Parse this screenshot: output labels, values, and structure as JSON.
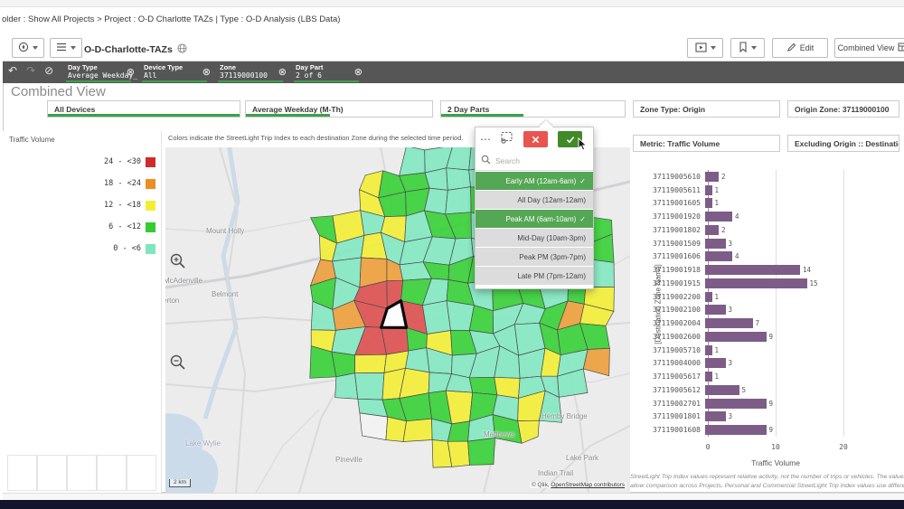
{
  "window": {
    "breadcrumb": "older : Show All Projects   >   Project : O-D Charlotte TAZs   |   Type : O-D Analysis (LBS Data)"
  },
  "toolbar": {
    "app_title": "O-D-Charlotte-TAZs",
    "edit_label": "Edit",
    "view_selector_label": "Combined View"
  },
  "selections": [
    {
      "label": "Day Type",
      "value": "Average Weekday_"
    },
    {
      "label": "Device Type",
      "value": "All"
    },
    {
      "label": "Zone",
      "value": "37119000100"
    },
    {
      "label": "Day Part",
      "value": "2 of 6"
    }
  ],
  "page": {
    "title": "Combined View"
  },
  "filters": {
    "all_devices": "All Devices",
    "day_type": "Average Weekday (M-Th)",
    "day_parts": "2 Day Parts",
    "zone_type": "Zone Type: Origin",
    "origin_zone": "Origin Zone: 37119000100",
    "metric": "Metric: Traffic Volume",
    "excluding": "Excluding Origin :: Destination"
  },
  "legend": {
    "title": "Traffic Volume",
    "items": [
      {
        "label": "24 - <30",
        "color": "#cf2b2b"
      },
      {
        "label": "18 - <24",
        "color": "#ef8d24"
      },
      {
        "label": "12 - <18",
        "color": "#f4ee33"
      },
      {
        "label": "6 - <12",
        "color": "#33cc33"
      },
      {
        "label": "0 - <6",
        "color": "#7fe7c0"
      }
    ]
  },
  "map": {
    "subtitle": "Colors indicate the StreetLight Trip Index to each destination Zone during the selected time period.",
    "places": [
      "Mount Holly",
      "McAdenville",
      "erton",
      "Belmont",
      "Lake Wylie",
      "Pineville",
      "Matthews",
      "Hemby Bridge",
      "Lake Park",
      "Indian Trail"
    ],
    "scale_label": "2 km",
    "attribution_prefix": "© Qlik, ",
    "attribution_link": "OpenStreetMap contributors"
  },
  "popup": {
    "search_placeholder": "Search",
    "options": [
      {
        "label": "Early AM (12am-6am)",
        "selected": true
      },
      {
        "label": "All Day (12am-12am)",
        "selected": false
      },
      {
        "label": "Peak AM (6am-10am)",
        "selected": true
      },
      {
        "label": "Mid-Day (10am-3pm)",
        "selected": false
      },
      {
        "label": "Peak PM (3pm-7pm)",
        "selected": false
      },
      {
        "label": "Late PM (7pm-12am)",
        "selected": false
      }
    ]
  },
  "chart_data": {
    "type": "bar",
    "orientation": "horizontal",
    "categories": [
      "37119005610",
      "37119005611",
      "37119001605",
      "37119001920",
      "37119001802",
      "37119001509",
      "37119001606",
      "37119001918",
      "37119001915",
      "37119002200",
      "37119002100",
      "37119002004",
      "37119002600",
      "37119005710",
      "37119004000",
      "37119005617",
      "37119005612",
      "37119002701",
      "37119001801",
      "37119001608"
    ],
    "values": [
      2,
      1,
      1,
      4,
      2,
      3,
      4,
      14,
      15,
      1,
      3,
      7,
      9,
      1,
      3,
      1,
      5,
      9,
      3,
      9
    ],
    "xlabel": "Traffic Volume",
    "ylabel": "[Destination Zone Name]",
    "x_ticks": [
      0,
      10,
      20
    ],
    "xlim": [
      0,
      28
    ],
    "bar_color": "#7d5c88"
  },
  "footnote": {
    "line1": "StreetLight Trip Index values represent relative activity, not the number of trips or vehicles. The values are ind",
    "line2": "allow comparison across Projects. Personal and Commercial StreetLight Trip Index values use different indi"
  },
  "colors": {
    "accent_green": "#3ba14b",
    "selected_green": "#54a754",
    "confirm_green": "#418a28",
    "cancel_red": "#e8544f",
    "bar_purple": "#7d5c88",
    "selection_bar": "#565656"
  }
}
